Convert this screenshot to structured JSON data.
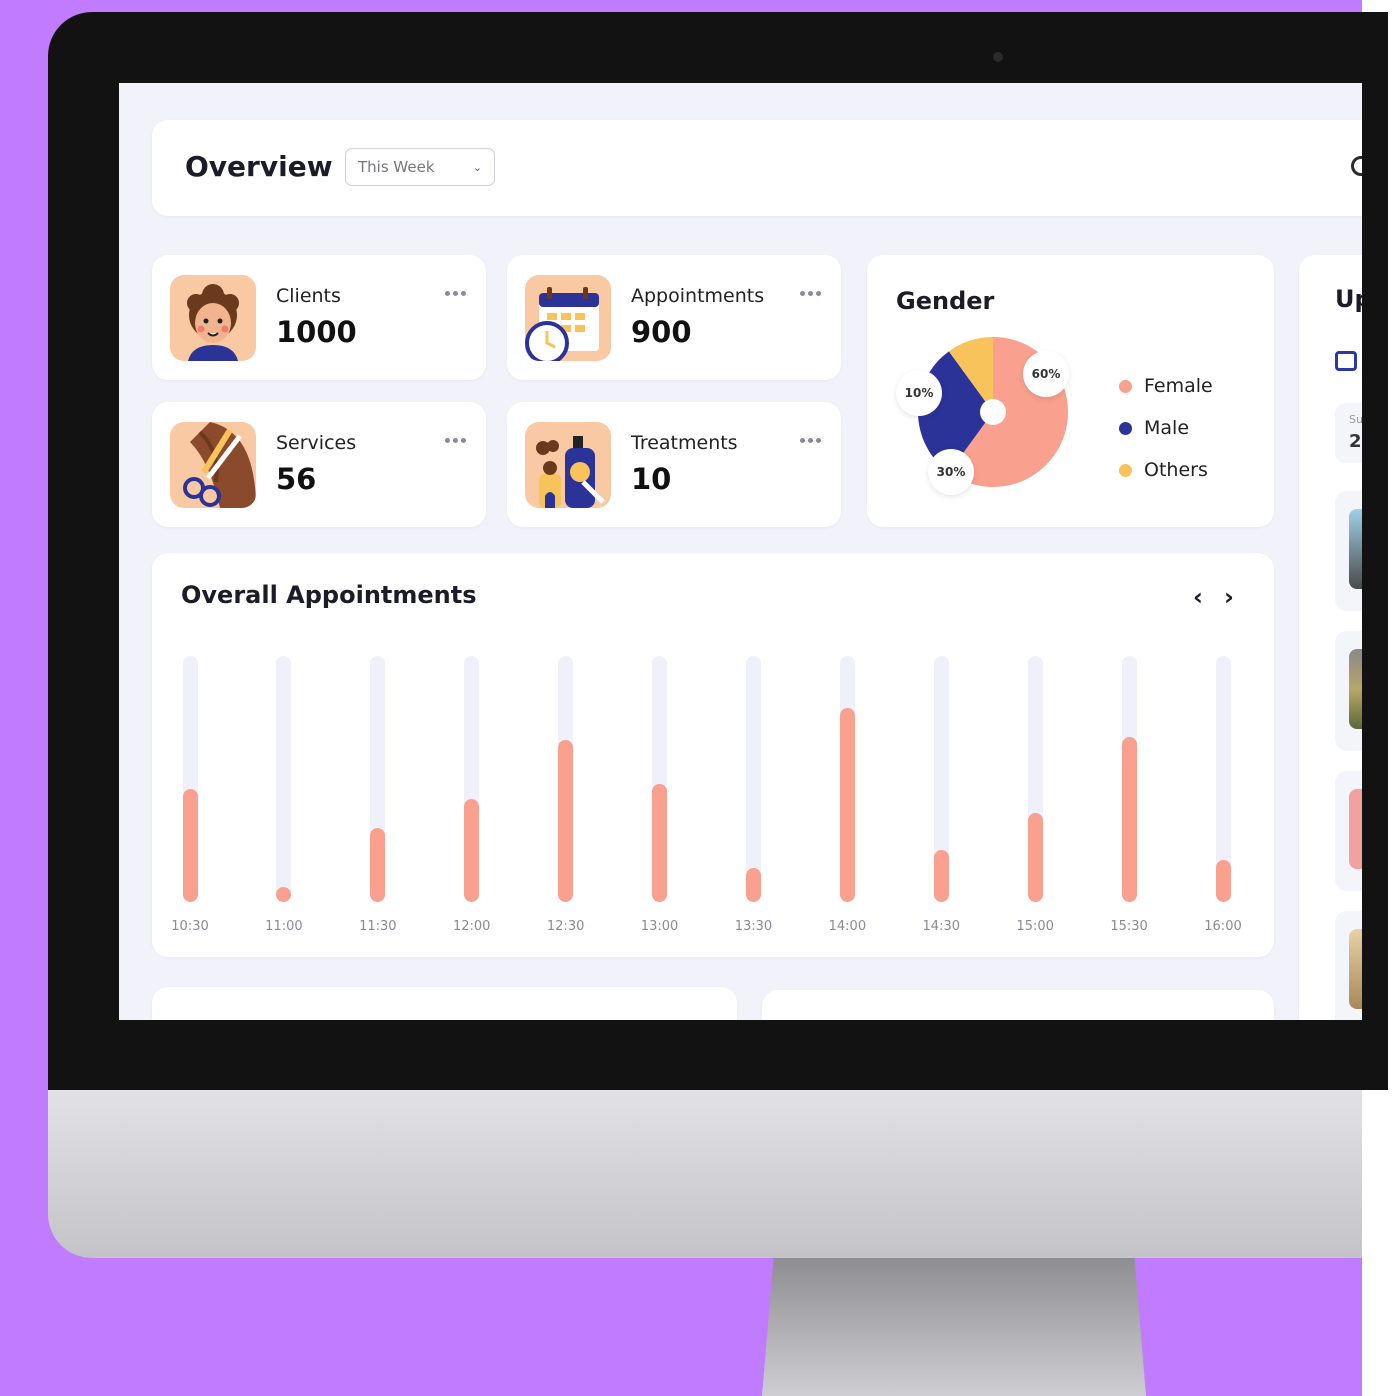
{
  "header": {
    "title": "Overview",
    "period_select": {
      "value": "This Week"
    }
  },
  "stats": [
    {
      "label": "Clients",
      "value": "1000",
      "icon": "client-avatar-icon"
    },
    {
      "label": "Appointments",
      "value": "900",
      "icon": "calendar-clock-icon"
    },
    {
      "label": "Services",
      "value": "56",
      "icon": "scissors-hair-icon"
    },
    {
      "label": "Treatments",
      "value": "10",
      "icon": "cosmetics-bottles-icon"
    }
  ],
  "gender": {
    "title": "Gender",
    "slices": [
      {
        "name": "Female",
        "percent": 60,
        "label": "60%",
        "color": "#f9a08f"
      },
      {
        "name": "Male",
        "percent": 30,
        "label": "30%",
        "color": "#2b3399"
      },
      {
        "name": "Others",
        "percent": 10,
        "label": "10%",
        "color": "#f7c35a"
      }
    ]
  },
  "chart_data": {
    "type": "bar",
    "title": "Overall Appointments",
    "categories": [
      "10:30",
      "11:00",
      "11:30",
      "12:00",
      "12:30",
      "13:00",
      "13:30",
      "14:00",
      "14:30",
      "15:00",
      "15:30",
      "16:00"
    ],
    "values": [
      46,
      6,
      30,
      42,
      66,
      48,
      14,
      79,
      21,
      36,
      67,
      17
    ],
    "ylim": [
      0,
      100
    ],
    "grid": false,
    "colors": {
      "fill": "#f9a08f",
      "track": "#eff0fa"
    }
  },
  "right_panel": {
    "title_partial": "Up",
    "date": {
      "day": "Su",
      "num": "2"
    }
  },
  "colors": {
    "accent": "#f9a08f",
    "brand": "#2b3399",
    "background": "#c17bff"
  }
}
